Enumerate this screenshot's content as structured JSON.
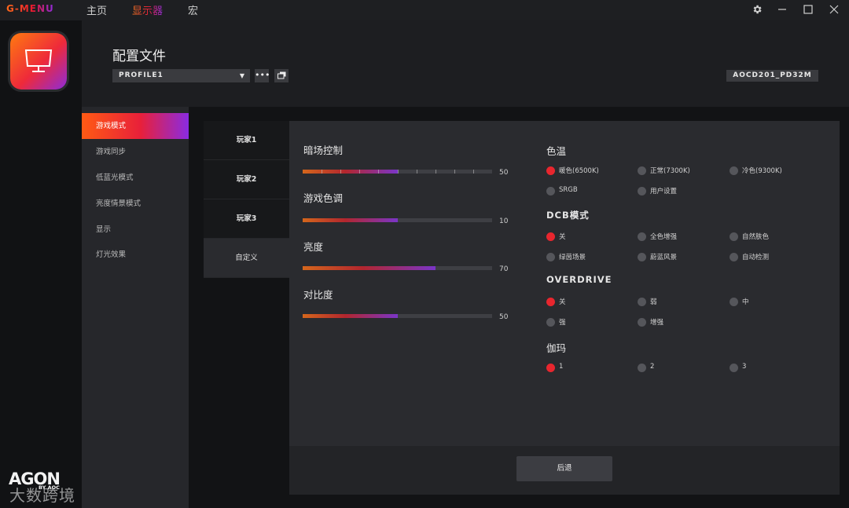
{
  "app": {
    "logo": "G-MENU"
  },
  "nav": [
    {
      "label": "主页",
      "active": false
    },
    {
      "label": "显示器",
      "active": true
    },
    {
      "label": "宏",
      "active": false
    }
  ],
  "window_controls": {
    "settings_icon": "gear-icon",
    "minimize_icon": "minimize-icon",
    "maximize_icon": "maximize-icon",
    "close_icon": "close-icon"
  },
  "header": {
    "title": "配置文件",
    "profile_value": "PROFILE1",
    "more_icon": "more-dots-icon",
    "window_icon": "window-switch-icon",
    "model": "AOCD201_PD32M"
  },
  "sidebar": {
    "items": [
      {
        "label": "游戏模式",
        "active": true
      },
      {
        "label": "游戏同步",
        "active": false
      },
      {
        "label": "低蓝光模式",
        "active": false
      },
      {
        "label": "亮度情景模式",
        "active": false
      },
      {
        "label": "显示",
        "active": false
      },
      {
        "label": "灯光效果",
        "active": false
      }
    ]
  },
  "players": [
    {
      "label": "玩家1",
      "active": false
    },
    {
      "label": "玩家2",
      "active": false
    },
    {
      "label": "玩家3",
      "active": false
    },
    {
      "label": "自定义",
      "active": true
    }
  ],
  "sliders": [
    {
      "label": "暗场控制",
      "value": 50,
      "max": 100,
      "ticks": true
    },
    {
      "label": "游戏色调",
      "value": 10,
      "max": 20,
      "ticks": false
    },
    {
      "label": "亮度",
      "value": 70,
      "max": 100,
      "ticks": false
    },
    {
      "label": "对比度",
      "value": 50,
      "max": 100,
      "ticks": false
    }
  ],
  "groups": [
    {
      "title": "色温",
      "bold": false,
      "options": [
        {
          "label": "暖色(6500K)",
          "selected": true
        },
        {
          "label": "正常(7300K)",
          "selected": false
        },
        {
          "label": "冷色(9300K)",
          "selected": false
        },
        {
          "label": "SRGB",
          "selected": false
        },
        {
          "label": "用户设置",
          "selected": false
        }
      ]
    },
    {
      "title": "DCB模式",
      "bold": true,
      "options": [
        {
          "label": "关",
          "selected": true
        },
        {
          "label": "全色增强",
          "selected": false
        },
        {
          "label": "自然肤色",
          "selected": false
        },
        {
          "label": "绿茵场景",
          "selected": false
        },
        {
          "label": "蔚蓝风景",
          "selected": false
        },
        {
          "label": "自动检测",
          "selected": false
        }
      ]
    },
    {
      "title": "OVERDRIVE",
      "bold": true,
      "options": [
        {
          "label": "关",
          "selected": true
        },
        {
          "label": "弱",
          "selected": false
        },
        {
          "label": "中",
          "selected": false
        },
        {
          "label": "强",
          "selected": false
        },
        {
          "label": "增强",
          "selected": false
        }
      ]
    },
    {
      "title": "伽玛",
      "bold": false,
      "options": [
        {
          "label": "1",
          "selected": true
        },
        {
          "label": "2",
          "selected": false
        },
        {
          "label": "3",
          "selected": false
        }
      ]
    }
  ],
  "footer": {
    "back_label": "后退"
  },
  "brand": {
    "name": "AGON",
    "sub": "BY AOC"
  },
  "watermark": "大数跨境",
  "colors": {
    "accent_orange": "#ff6a1a",
    "accent_red": "#e8262e",
    "accent_purple": "#8a2be2"
  }
}
